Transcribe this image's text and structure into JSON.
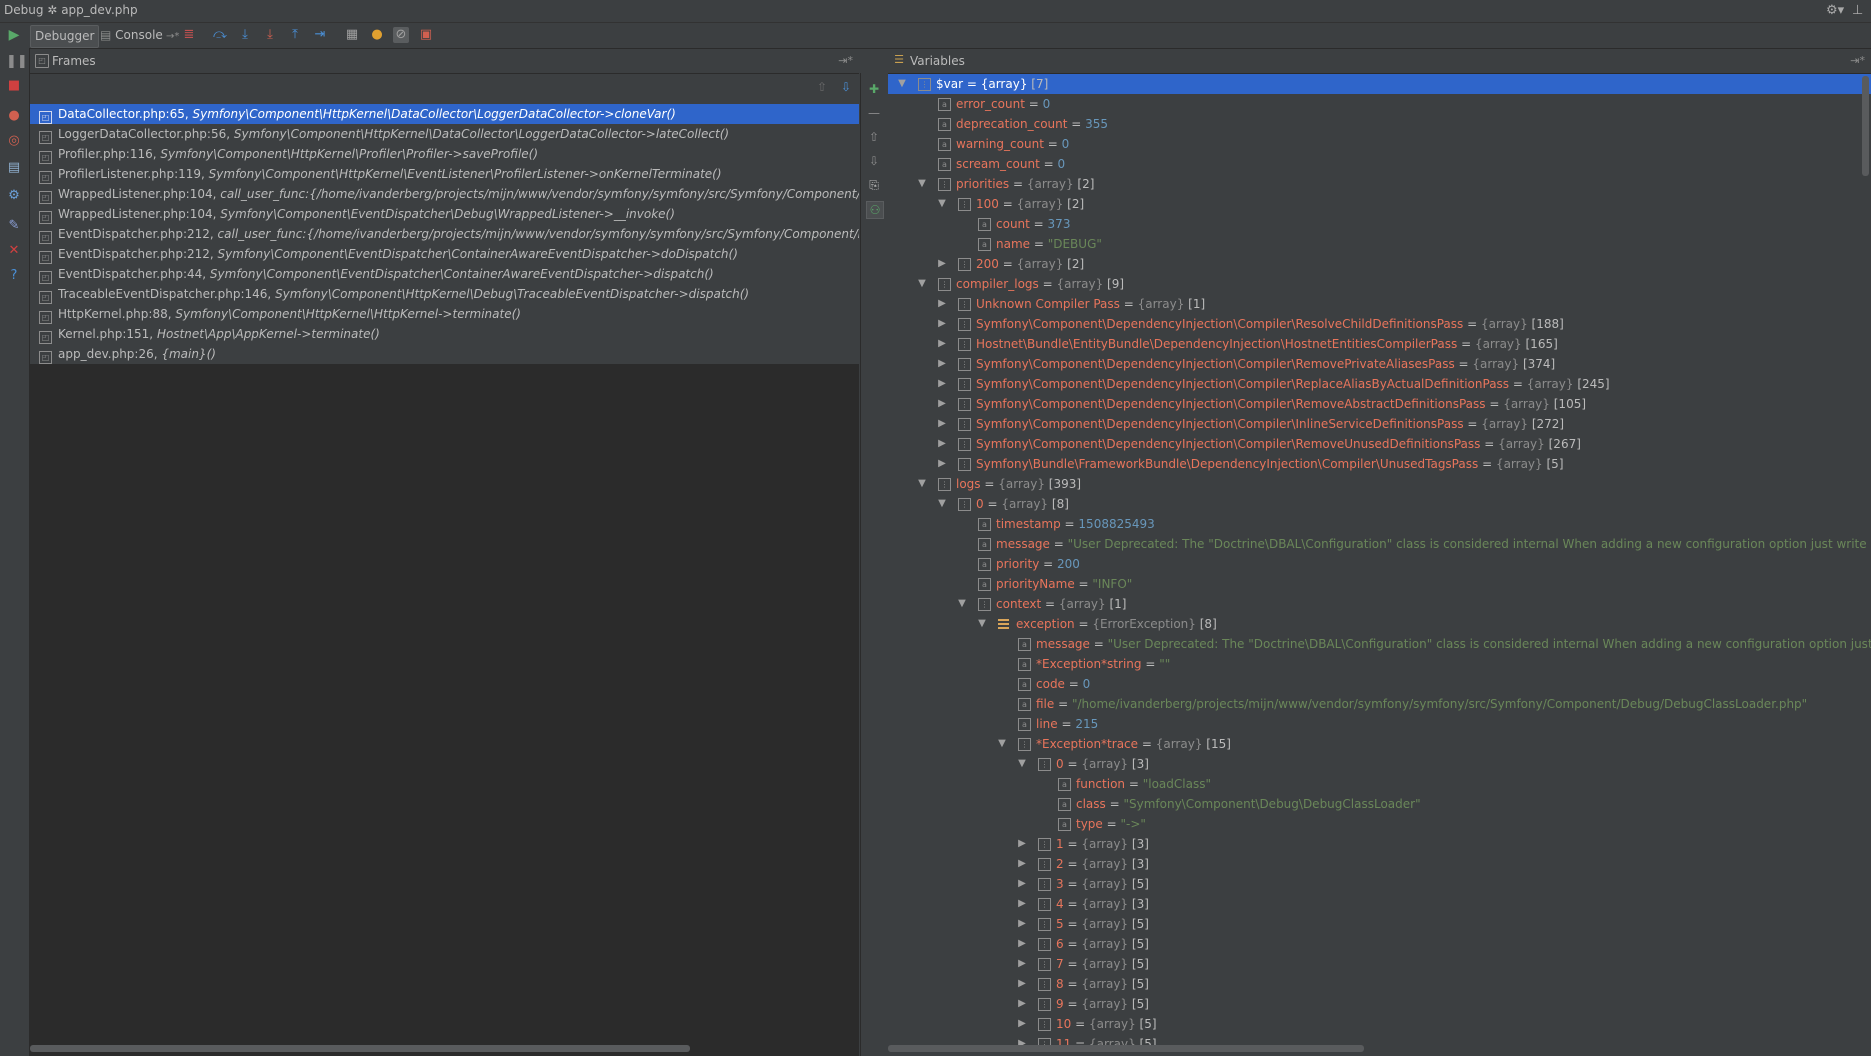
{
  "title": {
    "prefix": "Debug",
    "file": "app_dev.php"
  },
  "toolbar": {
    "debugger_tab": "Debugger",
    "console_tab": "Console"
  },
  "frames": {
    "header": "Frames",
    "items": [
      {
        "loc": "DataCollector.php:65, ",
        "fn": "Symfony\\Component\\HttpKernel\\DataCollector\\LoggerDataCollector->cloneVar()"
      },
      {
        "loc": "LoggerDataCollector.php:56, ",
        "fn": "Symfony\\Component\\HttpKernel\\DataCollector\\LoggerDataCollector->lateCollect()"
      },
      {
        "loc": "Profiler.php:116, ",
        "fn": "Symfony\\Component\\HttpKernel\\Profiler\\Profiler->saveProfile()"
      },
      {
        "loc": "ProfilerListener.php:119, ",
        "fn": "Symfony\\Component\\HttpKernel\\EventListener\\ProfilerListener->onKernelTerminate()"
      },
      {
        "loc": "WrappedListener.php:104, ",
        "fn": "call_user_func:{/home/ivanderberg/projects/mijn/www/vendor/symfony/symfony/src/Symfony/Component/EventDispatch"
      },
      {
        "loc": "WrappedListener.php:104, ",
        "fn": "Symfony\\Component\\EventDispatcher\\Debug\\WrappedListener->__invoke()"
      },
      {
        "loc": "EventDispatcher.php:212, ",
        "fn": "call_user_func:{/home/ivanderberg/projects/mijn/www/vendor/symfony/symfony/src/Symfony/Component/EventDispatche"
      },
      {
        "loc": "EventDispatcher.php:212, ",
        "fn": "Symfony\\Component\\EventDispatcher\\ContainerAwareEventDispatcher->doDispatch()"
      },
      {
        "loc": "EventDispatcher.php:44, ",
        "fn": "Symfony\\Component\\EventDispatcher\\ContainerAwareEventDispatcher->dispatch()"
      },
      {
        "loc": "TraceableEventDispatcher.php:146, ",
        "fn": "Symfony\\Component\\HttpKernel\\Debug\\TraceableEventDispatcher->dispatch()"
      },
      {
        "loc": "HttpKernel.php:88, ",
        "fn": "Symfony\\Component\\HttpKernel\\HttpKernel->terminate()"
      },
      {
        "loc": "Kernel.php:151, ",
        "fn": "Hostnet\\App\\AppKernel->terminate()"
      },
      {
        "loc": "app_dev.php:26, ",
        "fn": "{main}()"
      }
    ]
  },
  "variables": {
    "header": "Variables",
    "rows": [
      {
        "d": 0,
        "e": "open",
        "i": "arr",
        "name": "$var",
        "type": "{array}",
        "count": "[7]",
        "sel": true
      },
      {
        "d": 1,
        "i": "var",
        "name": "error_count",
        "num": "0"
      },
      {
        "d": 1,
        "i": "var",
        "name": "deprecation_count",
        "num": "355"
      },
      {
        "d": 1,
        "i": "var",
        "name": "warning_count",
        "num": "0"
      },
      {
        "d": 1,
        "i": "var",
        "name": "scream_count",
        "num": "0"
      },
      {
        "d": 1,
        "e": "open",
        "i": "arr",
        "name": "priorities",
        "type": "{array}",
        "count": "[2]"
      },
      {
        "d": 2,
        "e": "open",
        "i": "arr",
        "name": "100",
        "type": "{array}",
        "count": "[2]"
      },
      {
        "d": 3,
        "i": "var",
        "name": "count",
        "num": "373"
      },
      {
        "d": 3,
        "i": "var",
        "name": "name",
        "val": "\"DEBUG\""
      },
      {
        "d": 2,
        "e": "closed",
        "i": "arr",
        "name": "200",
        "type": "{array}",
        "count": "[2]"
      },
      {
        "d": 1,
        "e": "open",
        "i": "arr",
        "name": "compiler_logs",
        "type": "{array}",
        "count": "[9]"
      },
      {
        "d": 2,
        "e": "closed",
        "i": "arr",
        "name": "Unknown Compiler Pass",
        "type": "{array}",
        "count": "[1]"
      },
      {
        "d": 2,
        "e": "closed",
        "i": "arr",
        "name": "Symfony\\Component\\DependencyInjection\\Compiler\\ResolveChildDefinitionsPass",
        "type": "{array}",
        "count": "[188]"
      },
      {
        "d": 2,
        "e": "closed",
        "i": "arr",
        "name": "Hostnet\\Bundle\\EntityBundle\\DependencyInjection\\HostnetEntitiesCompilerPass",
        "type": "{array}",
        "count": "[165]"
      },
      {
        "d": 2,
        "e": "closed",
        "i": "arr",
        "name": "Symfony\\Component\\DependencyInjection\\Compiler\\RemovePrivateAliasesPass",
        "type": "{array}",
        "count": "[374]"
      },
      {
        "d": 2,
        "e": "closed",
        "i": "arr",
        "name": "Symfony\\Component\\DependencyInjection\\Compiler\\ReplaceAliasByActualDefinitionPass",
        "type": "{array}",
        "count": "[245]"
      },
      {
        "d": 2,
        "e": "closed",
        "i": "arr",
        "name": "Symfony\\Component\\DependencyInjection\\Compiler\\RemoveAbstractDefinitionsPass",
        "type": "{array}",
        "count": "[105]"
      },
      {
        "d": 2,
        "e": "closed",
        "i": "arr",
        "name": "Symfony\\Component\\DependencyInjection\\Compiler\\InlineServiceDefinitionsPass",
        "type": "{array}",
        "count": "[272]"
      },
      {
        "d": 2,
        "e": "closed",
        "i": "arr",
        "name": "Symfony\\Component\\DependencyInjection\\Compiler\\RemoveUnusedDefinitionsPass",
        "type": "{array}",
        "count": "[267]"
      },
      {
        "d": 2,
        "e": "closed",
        "i": "arr",
        "name": "Symfony\\Bundle\\FrameworkBundle\\DependencyInjection\\Compiler\\UnusedTagsPass",
        "type": "{array}",
        "count": "[5]"
      },
      {
        "d": 1,
        "e": "open",
        "i": "arr",
        "name": "logs",
        "type": "{array}",
        "count": "[393]"
      },
      {
        "d": 2,
        "e": "open",
        "i": "arr",
        "name": "0",
        "type": "{array}",
        "count": "[8]"
      },
      {
        "d": 3,
        "i": "var",
        "name": "timestamp",
        "num": "1508825493"
      },
      {
        "d": 3,
        "i": "var",
        "name": "message",
        "val": "\"User Deprecated: The \"Doctrine\\DBAL\\Configuration\" class is considered internal When adding a new configuration option just write a getter/setter"
      },
      {
        "d": 3,
        "i": "var",
        "name": "priority",
        "num": "200"
      },
      {
        "d": 3,
        "i": "var",
        "name": "priorityName",
        "val": "\"INFO\""
      },
      {
        "d": 3,
        "e": "open",
        "i": "arr",
        "name": "context",
        "type": "{array}",
        "count": "[1]"
      },
      {
        "d": 4,
        "e": "open",
        "i": "obj",
        "name": "exception",
        "type": "{ErrorException}",
        "count": "[8]"
      },
      {
        "d": 5,
        "i": "var",
        "name": "message",
        "val": "\"User Deprecated: The \"Doctrine\\DBAL\\Configuration\" class is considered internal When adding a new configuration option just write a getter"
      },
      {
        "d": 5,
        "i": "var",
        "name": "*Exception*string",
        "val": "\"\""
      },
      {
        "d": 5,
        "i": "var",
        "name": "code",
        "num": "0"
      },
      {
        "d": 5,
        "i": "var",
        "name": "file",
        "val": "\"/home/ivanderberg/projects/mijn/www/vendor/symfony/symfony/src/Symfony/Component/Debug/DebugClassLoader.php\""
      },
      {
        "d": 5,
        "i": "var",
        "name": "line",
        "num": "215"
      },
      {
        "d": 5,
        "e": "open",
        "i": "arr",
        "name": "*Exception*trace",
        "type": "{array}",
        "count": "[15]"
      },
      {
        "d": 6,
        "e": "open",
        "i": "arr",
        "name": "0",
        "type": "{array}",
        "count": "[3]"
      },
      {
        "d": 7,
        "i": "var",
        "name": "function",
        "val": "\"loadClass\""
      },
      {
        "d": 7,
        "i": "var",
        "name": "class",
        "val": "\"Symfony\\Component\\Debug\\DebugClassLoader\""
      },
      {
        "d": 7,
        "i": "var",
        "name": "type",
        "val": "\"->\""
      },
      {
        "d": 6,
        "e": "closed",
        "i": "arr",
        "name": "1",
        "type": "{array}",
        "count": "[3]"
      },
      {
        "d": 6,
        "e": "closed",
        "i": "arr",
        "name": "2",
        "type": "{array}",
        "count": "[3]"
      },
      {
        "d": 6,
        "e": "closed",
        "i": "arr",
        "name": "3",
        "type": "{array}",
        "count": "[5]"
      },
      {
        "d": 6,
        "e": "closed",
        "i": "arr",
        "name": "4",
        "type": "{array}",
        "count": "[3]"
      },
      {
        "d": 6,
        "e": "closed",
        "i": "arr",
        "name": "5",
        "type": "{array}",
        "count": "[5]"
      },
      {
        "d": 6,
        "e": "closed",
        "i": "arr",
        "name": "6",
        "type": "{array}",
        "count": "[5]"
      },
      {
        "d": 6,
        "e": "closed",
        "i": "arr",
        "name": "7",
        "type": "{array}",
        "count": "[5]"
      },
      {
        "d": 6,
        "e": "closed",
        "i": "arr",
        "name": "8",
        "type": "{array}",
        "count": "[5]"
      },
      {
        "d": 6,
        "e": "closed",
        "i": "arr",
        "name": "9",
        "type": "{array}",
        "count": "[5]"
      },
      {
        "d": 6,
        "e": "closed",
        "i": "arr",
        "name": "10",
        "type": "{array}",
        "count": "[5]"
      },
      {
        "d": 6,
        "e": "closed",
        "i": "arr",
        "name": "11",
        "type": "{array}",
        "count": "[5]"
      }
    ]
  },
  "colors": {
    "selection": "#2f65ca",
    "name": "#e8755c",
    "number": "#6897bb",
    "string": "#6a8759",
    "type": "#8c8c8c"
  }
}
